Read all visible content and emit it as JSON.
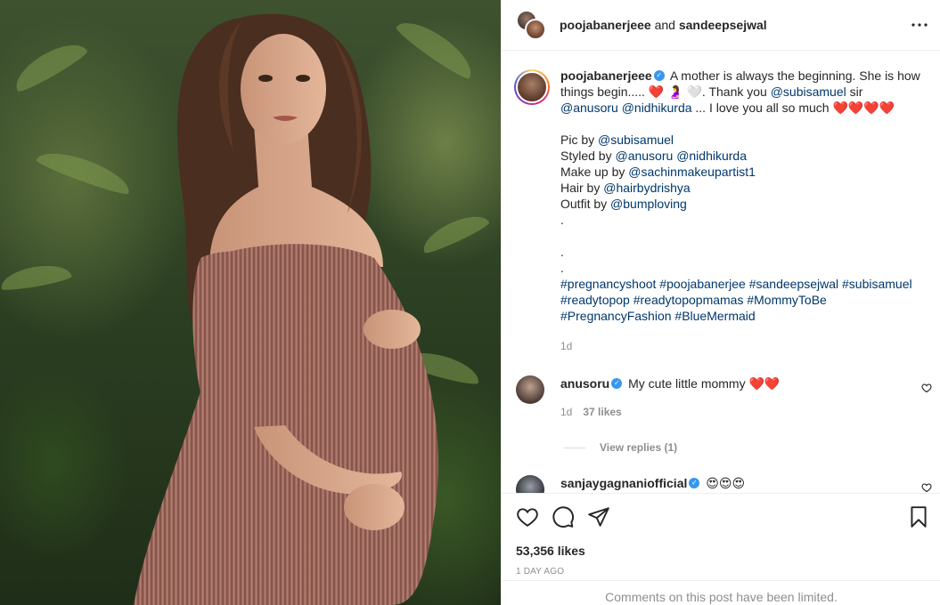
{
  "header": {
    "user1": "poojabanerjeee",
    "joiner": "and",
    "user2": "sandeepsejwal",
    "more_icon": "more-horizontal-icon"
  },
  "caption": {
    "username": "poojabanerjeee",
    "line1_text": " A mother is always the beginning. She is how things begin..... ",
    "line1_emoji": "❤️ 🤰 🤍",
    "line1_thanks": ". Thank you ",
    "mention_subi": "@subisamuel",
    "sir": " sir ",
    "mention_anu": "@anusoru",
    "mention_nidhi": "@nidhikurda",
    "love": " ... I love you all so much ",
    "hearts4": "❤️❤️❤️❤️",
    "pic_by": "Pic by ",
    "pic_by_handle": "@subisamuel",
    "styled_by": "Styled by ",
    "styled_by_h1": "@anusoru",
    "styled_by_h2": "@nidhikurda",
    "makeup_by": "Make up by ",
    "makeup_by_handle": "@sachinmakeupartist1",
    "hair_by": "Hair by ",
    "hair_by_handle": "@hairbydrishya",
    "outfit_by": "Outfit by ",
    "outfit_by_handle": "@bumploving",
    "dot": ".",
    "hashtags_line1": "#pregnancyshoot #poojabanerjee #sandeepsejwal #subisamuel",
    "hashtags_line2": "#readytopop #readytopopmamas #MommyToBe",
    "hashtags_line3": "#PregnancyFashion #BlueMermaid",
    "time": "1d"
  },
  "comments": [
    {
      "username": "anusoru",
      "text": " My cute little mommy ",
      "emoji": "❤️❤️",
      "time": "1d",
      "likes": "37 likes",
      "view_replies": "View replies (1)"
    },
    {
      "username": "sanjaygagnaniofficial",
      "emoji": "😍😍😍"
    }
  ],
  "actions": {
    "like_icon": "heart-icon",
    "comment_icon": "comment-icon",
    "share_icon": "share-icon",
    "save_icon": "bookmark-icon"
  },
  "likes": "53,356 likes",
  "date": "1 DAY AGO",
  "limited": "Comments on this post have been limited."
}
